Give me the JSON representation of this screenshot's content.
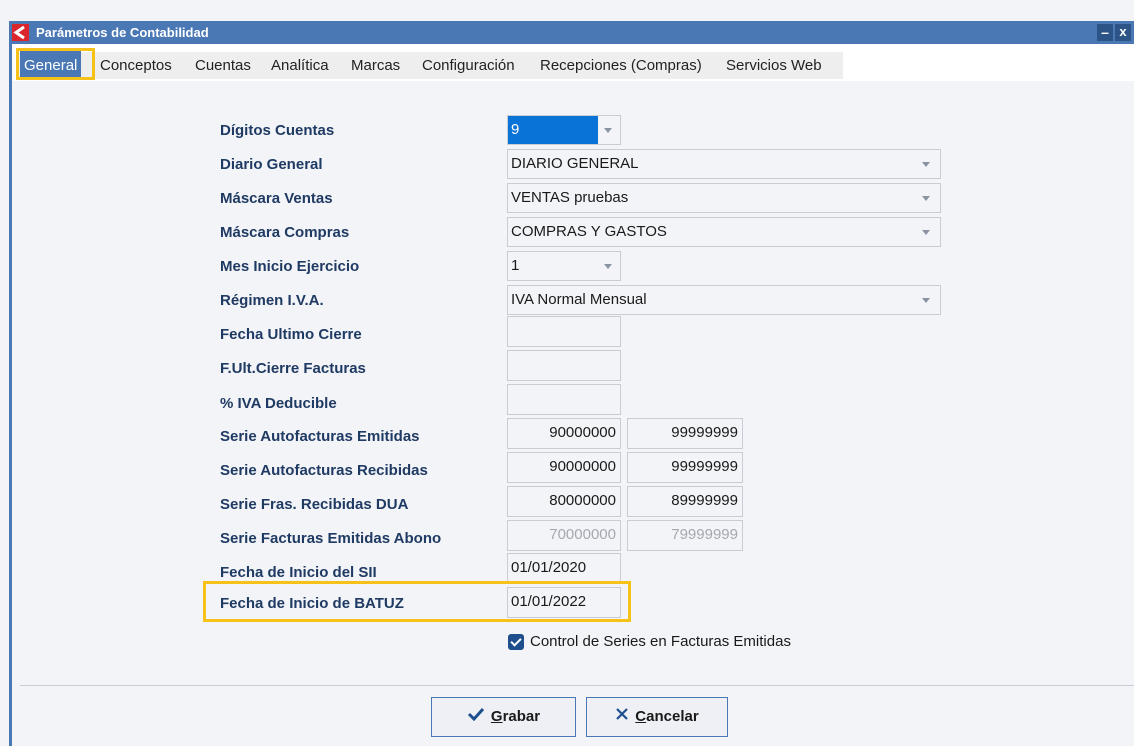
{
  "window": {
    "title": "Parámetros de Contabilidad",
    "minimize": "–",
    "close": "x"
  },
  "tabs": [
    {
      "label": "General"
    },
    {
      "label": "Conceptos"
    },
    {
      "label": "Cuentas"
    },
    {
      "label": "Analítica"
    },
    {
      "label": "Marcas"
    },
    {
      "label": "Configuración"
    },
    {
      "label": "Recepciones (Compras)"
    },
    {
      "label": "Servicios Web"
    }
  ],
  "form": {
    "digitos_cuentas": {
      "label": "Dígitos Cuentas",
      "value": "9"
    },
    "diario_general": {
      "label": "Diario General",
      "value": "DIARIO GENERAL"
    },
    "mascara_ventas": {
      "label": "Máscara Ventas",
      "value": "VENTAS pruebas"
    },
    "mascara_compras": {
      "label": "Máscara Compras",
      "value": "COMPRAS Y GASTOS"
    },
    "mes_inicio": {
      "label": "Mes Inicio Ejercicio",
      "value": "1"
    },
    "regimen_iva": {
      "label": "Régimen I.V.A.",
      "value": "IVA Normal Mensual"
    },
    "fecha_ultimo_cierre": {
      "label": "Fecha Ultimo Cierre",
      "value": ""
    },
    "f_ult_cierre_facturas": {
      "label": "F.Ult.Cierre Facturas",
      "value": ""
    },
    "iva_deducible": {
      "label": "% IVA Deducible",
      "value": ""
    },
    "serie_autofacturas_emitidas": {
      "label": "Serie Autofacturas Emitidas",
      "from": "90000000",
      "to": "99999999"
    },
    "serie_autofacturas_recibidas": {
      "label": "Serie Autofacturas Recibidas",
      "from": "90000000",
      "to": "99999999"
    },
    "serie_fras_recibidas_dua": {
      "label": "Serie Fras. Recibidas DUA",
      "from": "80000000",
      "to": "89999999"
    },
    "serie_facturas_emitidas_abono": {
      "label": "Serie Facturas Emitidas Abono",
      "from": "70000000",
      "to": "79999999"
    },
    "fecha_inicio_sii": {
      "label": "Fecha de Inicio del SII",
      "value": "01/01/2020"
    },
    "fecha_inicio_batuz": {
      "label": "Fecha de Inicio de BATUZ",
      "value": "01/01/2022"
    },
    "control_series": {
      "label": "Control de Series en Facturas Emitidas",
      "checked": true
    }
  },
  "buttons": {
    "save": {
      "underline": "G",
      "rest": "rabar"
    },
    "cancel": {
      "underline": "C",
      "rest": "ancelar"
    }
  },
  "colors": {
    "accent": "#4a78b5",
    "highlight": "#f6c21a",
    "label": "#1f3a63",
    "selection": "#0a73d8"
  }
}
